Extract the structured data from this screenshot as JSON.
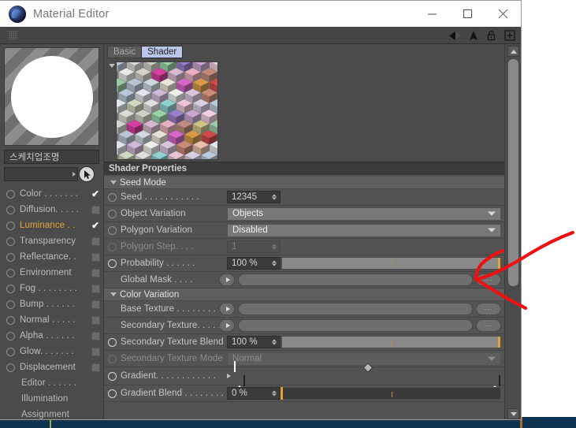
{
  "window": {
    "title": "Material Editor",
    "logo_icon": "cinema4d-logo-icon",
    "minimize_label": "minimize-icon",
    "maximize_label": "maximize-icon",
    "close_label": "close-icon"
  },
  "toolbar": {
    "grip": "drag-grip-icon",
    "icons": [
      "back-arrow-icon",
      "up-arrow-icon",
      "lock-icon",
      "add-panel-icon"
    ]
  },
  "material": {
    "name": "스케치업조명",
    "name_field_value": "",
    "preview_alt": "material-preview-sphere",
    "cursor_icon": "mouse-cursor-icon"
  },
  "channels": [
    {
      "label": "Color . . . . . . .",
      "enabled": true,
      "checked": true,
      "active": false,
      "sub": false
    },
    {
      "label": "Diffusion. . . . .",
      "enabled": true,
      "checked": false,
      "active": false,
      "sub": false
    },
    {
      "label": "Luminance . .",
      "enabled": true,
      "checked": true,
      "active": true,
      "sub": false
    },
    {
      "label": "Transparency",
      "enabled": true,
      "checked": false,
      "active": false,
      "sub": false
    },
    {
      "label": "Reflectance. .",
      "enabled": true,
      "checked": false,
      "active": false,
      "sub": false
    },
    {
      "label": "Environment",
      "enabled": true,
      "checked": false,
      "active": false,
      "sub": false
    },
    {
      "label": "Fog . . . . . . . .",
      "enabled": true,
      "checked": false,
      "active": false,
      "sub": false
    },
    {
      "label": "Bump . . . . . .",
      "enabled": true,
      "checked": false,
      "active": false,
      "sub": false
    },
    {
      "label": "Normal . . . . .",
      "enabled": true,
      "checked": false,
      "active": false,
      "sub": false
    },
    {
      "label": "Alpha . . . . . .",
      "enabled": true,
      "checked": false,
      "active": false,
      "sub": false
    },
    {
      "label": "Glow. . . . . . .",
      "enabled": true,
      "checked": false,
      "active": false,
      "sub": false
    },
    {
      "label": "Displacement",
      "enabled": true,
      "checked": false,
      "active": false,
      "sub": false
    },
    {
      "label": "Editor . . . . . .",
      "enabled": false,
      "checked": false,
      "active": false,
      "sub": true
    },
    {
      "label": "Illumination",
      "enabled": false,
      "checked": false,
      "active": false,
      "sub": true
    },
    {
      "label": "Assignment",
      "enabled": false,
      "checked": false,
      "active": false,
      "sub": true
    }
  ],
  "tabs": [
    {
      "label": "Basic",
      "selected": false
    },
    {
      "label": "Shader",
      "selected": true
    }
  ],
  "properties": {
    "header": "Shader Properties",
    "groups": [
      {
        "title": "Seed Mode",
        "rows": [
          {
            "type": "number",
            "label": "Seed . . . . . . . . . . .",
            "value": "12345",
            "disabled": false,
            "width": 68
          },
          {
            "type": "combo",
            "label": "Object Variation",
            "value": "Objects",
            "disabled": false
          },
          {
            "type": "combo",
            "label": "Polygon Variation",
            "value": "Disabled",
            "disabled": false
          },
          {
            "type": "number",
            "label": "Polygon Step. . . .",
            "value": "1",
            "disabled": true,
            "width": 68
          },
          {
            "type": "slider",
            "label": "Probability . . . . . .",
            "value": "100 %",
            "fill": 100,
            "disabled": false
          }
        ]
      },
      {
        "title": null,
        "rows": [
          {
            "type": "texture",
            "label": "Global Mask . . . .",
            "value": "",
            "disabled": false,
            "ell": "..."
          }
        ]
      },
      {
        "title": "Color Variation",
        "rows": [
          {
            "type": "texture",
            "label": "Base Texture . . . . . . . . . .",
            "value": "",
            "disabled": false,
            "ell": "..."
          },
          {
            "type": "texture",
            "label": "Secondary Texture. . . . . .",
            "value": "",
            "disabled": false,
            "ell": "..."
          },
          {
            "type": "slider",
            "label": "Secondary Texture Blend",
            "value": "100 %",
            "fill": 100,
            "disabled": false
          },
          {
            "type": "combo",
            "label": "Secondary Texture Mode",
            "value": "Normal",
            "disabled": true
          },
          {
            "type": "gradient",
            "label": "Gradient. . . . . . . . . . . .",
            "disabled": false
          },
          {
            "type": "slider",
            "label": "Gradient Blend . . . . . . . .",
            "value": "0 %",
            "fill": 0,
            "disabled": false
          }
        ]
      }
    ]
  },
  "gradient": {
    "start_color": "#1d1df0",
    "end_color": "#ffffff",
    "knob_position_pct": 50,
    "stops": [
      {
        "position_pct": 0,
        "color": "#1d1df0"
      },
      {
        "position_pct": 100,
        "color": "#ffffff"
      }
    ]
  },
  "scrollbar": {
    "up_icon": "scroll-up-icon",
    "down_icon": "scroll-down-icon",
    "thumb_position_pct": 4
  },
  "annotation": {
    "color": "#ee1111",
    "description": "red-arrow-pointing-to-global-mask-browse-button"
  }
}
